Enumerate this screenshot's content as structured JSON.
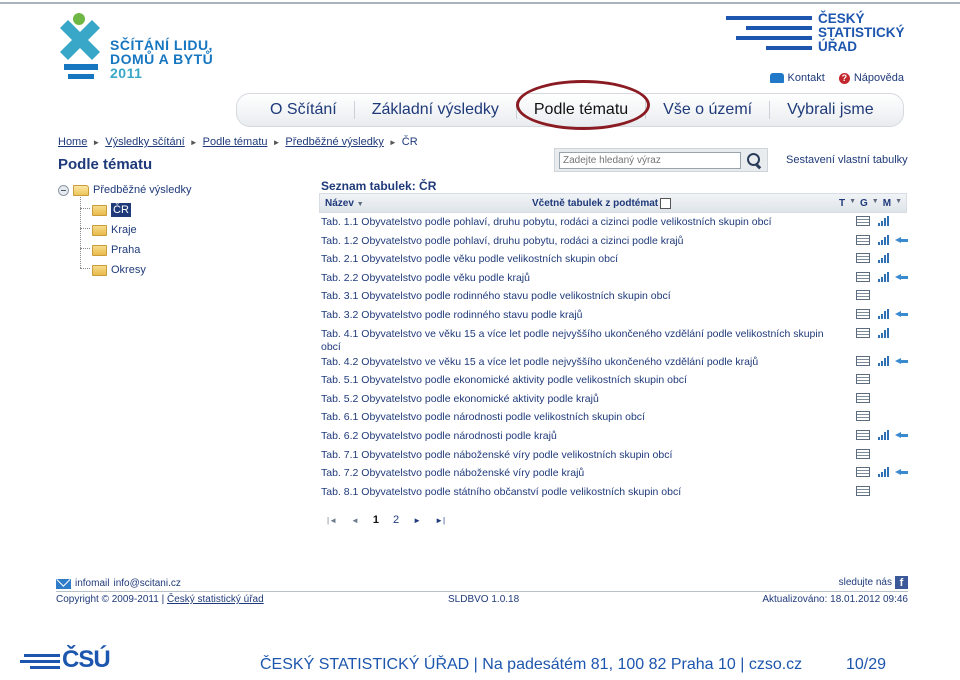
{
  "logo": {
    "line1": "SČÍTÁNÍ LIDU,",
    "line2": "DOMŮ A BYTŮ",
    "line3": "2011",
    "csu_line1": "ČESKÝ",
    "csu_line2": "STATISTICKÝ",
    "csu_line3": "ÚŘAD"
  },
  "toplinks": {
    "contact": "Kontakt",
    "help": "Nápověda"
  },
  "nav": {
    "tabs": [
      "O Sčítání",
      "Základní výsledky",
      "Podle tématu",
      "Vše o území",
      "Vybrali jsme"
    ],
    "active_index": 2
  },
  "breadcrumb": {
    "items": [
      "Home",
      "Výsledky sčítání",
      "Podle tématu",
      "Předběžné výsledky"
    ],
    "current": "ČR"
  },
  "page_title": "Podle tématu",
  "search": {
    "placeholder": "Zadejte hledaný výraz",
    "custom_tables": "Sestavení vlastní tabulky"
  },
  "tree": {
    "root": "Předběžné výsledky",
    "children": [
      "ČR",
      "Kraje",
      "Praha",
      "Okresy"
    ],
    "selected_index": 0
  },
  "list": {
    "title": "Seznam tabulek: ČR",
    "col_name": "Název",
    "col_include": "Včetně tabulek z podtémat",
    "col_t": "T",
    "col_g": "G",
    "col_m": "M",
    "rows": [
      {
        "text": "Tab. 1.1 Obyvatelstvo podle pohlaví, druhu pobytu, rodáci a cizinci podle velikostních skupin obcí",
        "g": true,
        "m": false
      },
      {
        "text": "Tab. 1.2 Obyvatelstvo podle pohlaví, druhu pobytu, rodáci a cizinci podle krajů",
        "g": true,
        "m": true
      },
      {
        "text": "Tab. 2.1 Obyvatelstvo podle věku podle velikostních skupin obcí",
        "g": true,
        "m": false
      },
      {
        "text": "Tab. 2.2 Obyvatelstvo podle věku podle krajů",
        "g": true,
        "m": true
      },
      {
        "text": "Tab. 3.1 Obyvatelstvo podle rodinného stavu podle velikostních skupin obcí",
        "g": false,
        "m": false
      },
      {
        "text": "Tab. 3.2 Obyvatelstvo podle rodinného stavu podle krajů",
        "g": true,
        "m": true
      },
      {
        "text": "Tab. 4.1 Obyvatelstvo ve věku 15 a více let podle nejvyššího ukončeného vzdělání podle velikostních skupin obcí",
        "g": true,
        "m": false
      },
      {
        "text": "Tab. 4.2 Obyvatelstvo ve věku 15 a více let podle nejvyššího ukončeného vzdělání podle krajů",
        "g": true,
        "m": true
      },
      {
        "text": "Tab. 5.1 Obyvatelstvo podle ekonomické aktivity podle velikostních skupin obcí",
        "g": false,
        "m": false
      },
      {
        "text": "Tab. 5.2 Obyvatelstvo podle ekonomické aktivity podle krajů",
        "g": false,
        "m": false
      },
      {
        "text": "Tab. 6.1 Obyvatelstvo podle národnosti podle velikostních skupin obcí",
        "g": false,
        "m": false
      },
      {
        "text": "Tab. 6.2 Obyvatelstvo podle národnosti podle krajů",
        "g": true,
        "m": true
      },
      {
        "text": "Tab. 7.1 Obyvatelstvo podle náboženské víry podle velikostních skupin obcí",
        "g": false,
        "m": false
      },
      {
        "text": "Tab. 7.2 Obyvatelstvo podle náboženské víry podle krajů",
        "g": true,
        "m": true
      },
      {
        "text": "Tab. 8.1 Obyvatelstvo podle státního občanství podle velikostních skupin obcí",
        "g": false,
        "m": false
      }
    ]
  },
  "pager": {
    "pages": [
      "1",
      "2"
    ],
    "current": "1"
  },
  "footer": {
    "infomail_label": "infomail",
    "infomail_email": "info@scitani.cz",
    "follow": "sledujte nás",
    "copyright": "Copyright © 2009-2011",
    "org": "Český statistický úřad",
    "version": "SLDBVO 1.0.18",
    "updated": "Aktualizováno: 18.01.2012 09:46"
  },
  "slide": {
    "logo_text": "ČSÚ",
    "footer_text": "ČESKÝ STATISTICKÝ ÚŘAD  |  Na padesátém 81, 100 82 Praha 10  |  czso.cz",
    "page": "10/29"
  },
  "colors": {
    "brand": "#1d56ae",
    "text": "#1f3a7a",
    "highlight": "#8a1b22",
    "green": "#6fb744"
  }
}
